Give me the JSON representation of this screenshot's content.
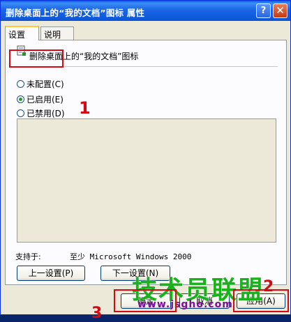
{
  "window": {
    "title": "删除桌面上的“我的文档”图标 属性",
    "help_glyph": "?",
    "close_glyph": "✕"
  },
  "tabs": [
    {
      "label": "设置"
    },
    {
      "label": "说明"
    }
  ],
  "policy": {
    "icon": "policy-document-icon",
    "name": "删除桌面上的“我的文档”图标"
  },
  "options": [
    {
      "label": "未配置(C)",
      "checked": false
    },
    {
      "label": "已启用(E)",
      "checked": true
    },
    {
      "label": "已禁用(D)",
      "checked": false
    }
  ],
  "support": {
    "label": "支持于:",
    "value": "至少 Microsoft Windows 2000"
  },
  "nav_buttons": {
    "prev": "上一设置(P)",
    "next": "下一设置(N)"
  },
  "dialog_buttons": {
    "ok": "确定",
    "cancel": "取消",
    "apply": "应用(A)"
  },
  "annotations": {
    "step1": "1",
    "step2": "2",
    "step3": "3"
  },
  "watermark": {
    "text": "技术员联盟",
    "url": "www.jsgho.com"
  },
  "colors": {
    "annotation": "#d10a14",
    "titlebar": "#0b55d5",
    "watermark": "#18b21a"
  }
}
